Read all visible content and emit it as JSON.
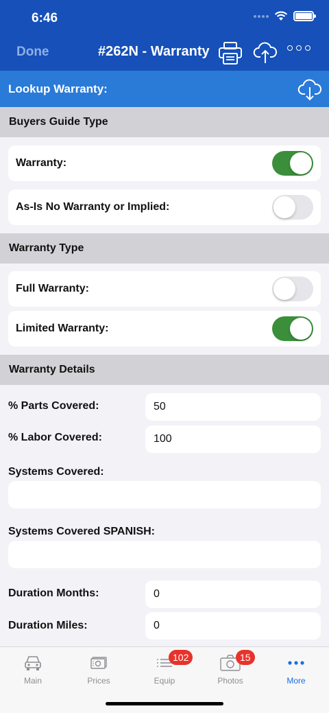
{
  "status_bar": {
    "time": "6:46"
  },
  "nav": {
    "done_label": "Done",
    "title": "#262N - Warranty"
  },
  "lookup": {
    "label": "Lookup Warranty:"
  },
  "buyers_guide": {
    "header": "Buyers Guide Type",
    "warranty_label": "Warranty:",
    "warranty_on": true,
    "asis_label": "As-Is No Warranty or Implied:",
    "asis_on": false
  },
  "warranty_type": {
    "header": "Warranty Type",
    "full_label": "Full Warranty:",
    "full_on": false,
    "limited_label": "Limited Warranty:",
    "limited_on": true
  },
  "warranty_details": {
    "header": "Warranty Details",
    "parts_label": "% Parts Covered:",
    "parts_value": "50",
    "labor_label": "% Labor Covered:",
    "labor_value": "100",
    "systems_label": "Systems Covered:",
    "systems_value": "",
    "systems_spanish_label": "Systems Covered SPANISH:",
    "systems_spanish_value": "",
    "months_label": "Duration Months:",
    "months_value": "0",
    "miles_label": "Duration Miles:",
    "miles_value": "0"
  },
  "tabs": [
    {
      "label": "Main",
      "icon": "car-icon",
      "badge": ""
    },
    {
      "label": "Prices",
      "icon": "money-icon",
      "badge": ""
    },
    {
      "label": "Equip",
      "icon": "list-icon",
      "badge": "102"
    },
    {
      "label": "Photos",
      "icon": "camera-icon",
      "badge": "15"
    },
    {
      "label": "More",
      "icon": "more-dots-icon",
      "badge": ""
    }
  ],
  "active_tab": "More",
  "colors": {
    "nav_bar": "#1650b8",
    "lookup_bar": "#2a7ad8",
    "switch_on": "#3b8f3b",
    "badge": "#e8322b",
    "active_tab": "#1a6fe0"
  }
}
